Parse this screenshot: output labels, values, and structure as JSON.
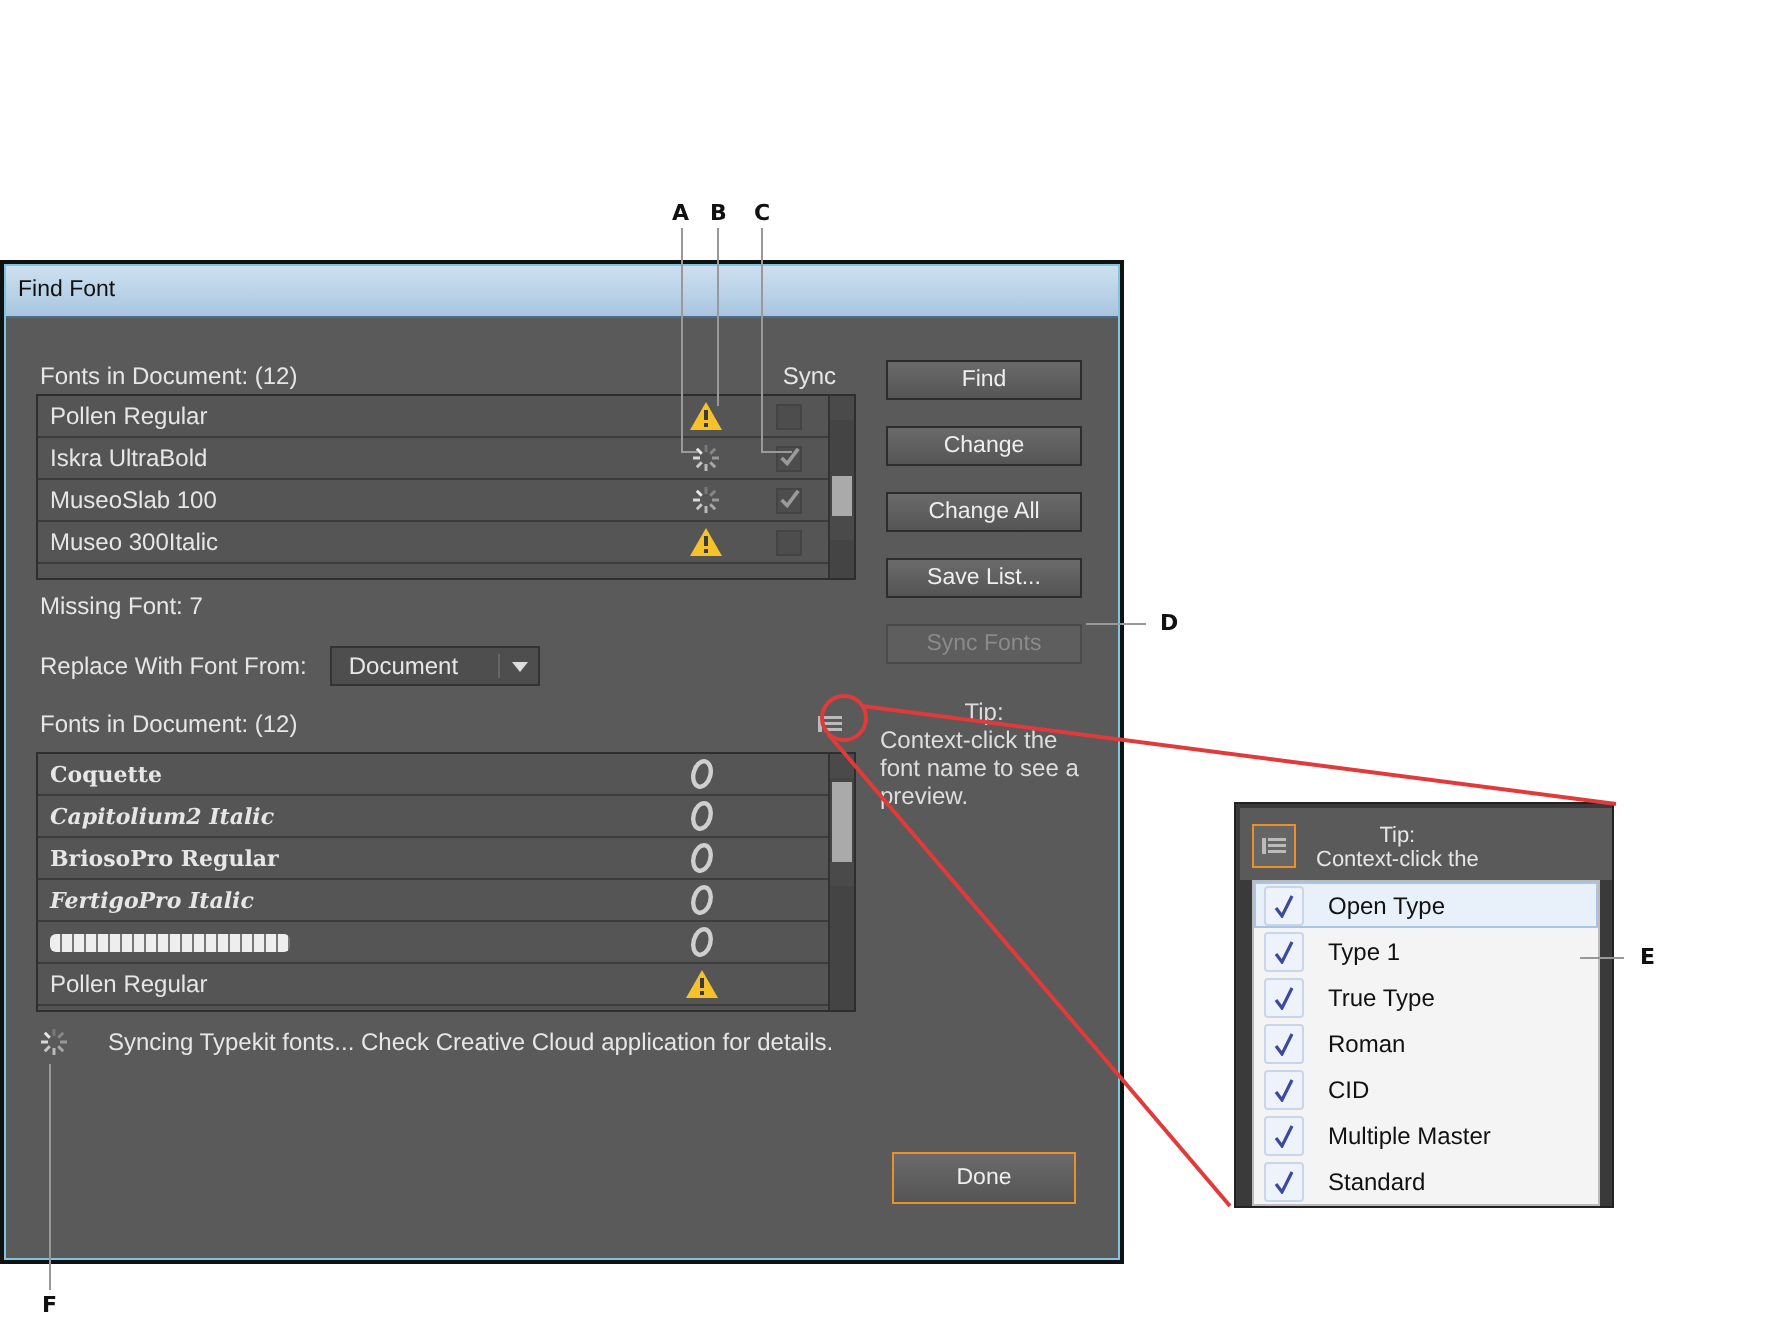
{
  "window": {
    "title": "Find Font"
  },
  "fonts_in_document": {
    "label": "Fonts in Document: (12)",
    "sync_header": "Sync",
    "rows": [
      {
        "name": "Pollen Regular",
        "warning": true,
        "sync_checked": false
      },
      {
        "name": "Iskra UltraBold",
        "warning": false,
        "sync_checked": true
      },
      {
        "name": "MuseoSlab 100",
        "warning": false,
        "sync_checked": true
      },
      {
        "name": "Museo 300Italic",
        "warning": true,
        "sync_checked": false
      }
    ]
  },
  "buttons": [
    {
      "label": "Find",
      "disabled": false
    },
    {
      "label": "Change",
      "disabled": false
    },
    {
      "label": "Change All",
      "disabled": false
    },
    {
      "label": "Save List...",
      "disabled": false
    },
    {
      "label": "Sync Fonts",
      "disabled": true
    }
  ],
  "missing_font": "Missing Font: 7",
  "replace": {
    "label": "Replace With Font From:",
    "value": "Document"
  },
  "replacement_fonts": {
    "label": "Fonts in Document: (12)",
    "rows": [
      {
        "name": "Coquette",
        "kind": "preview",
        "warning": false
      },
      {
        "name": "Capitolium2 Italic",
        "kind": "preview-italic",
        "warning": false
      },
      {
        "name": "BriosoPro Regular",
        "kind": "preview",
        "warning": false
      },
      {
        "name": "FertigoPro Italic",
        "kind": "preview-italic",
        "warning": false
      },
      {
        "name": "",
        "kind": "illegible",
        "warning": false
      },
      {
        "name": "Pollen Regular",
        "kind": "plain",
        "warning": true
      }
    ]
  },
  "tip": {
    "title": "Tip:",
    "text": "Context-click the font name to see a preview."
  },
  "status_message": "Syncing Typekit fonts... Check Creative Cloud application for details.",
  "done_button": "Done",
  "inset": {
    "tip_title": "Tip:",
    "tip_text": "Context-click the",
    "menu": [
      {
        "label": "Open Type",
        "checked": true,
        "highlighted": true
      },
      {
        "label": "Type 1",
        "checked": true,
        "highlighted": false
      },
      {
        "label": "True Type",
        "checked": true,
        "highlighted": false
      },
      {
        "label": "Roman",
        "checked": true,
        "highlighted": false
      },
      {
        "label": "CID",
        "checked": true,
        "highlighted": false
      },
      {
        "label": "Multiple Master",
        "checked": true,
        "highlighted": false
      },
      {
        "label": "Standard",
        "checked": true,
        "highlighted": false
      }
    ]
  },
  "callouts": [
    "A",
    "B",
    "C",
    "D",
    "E",
    "F"
  ]
}
